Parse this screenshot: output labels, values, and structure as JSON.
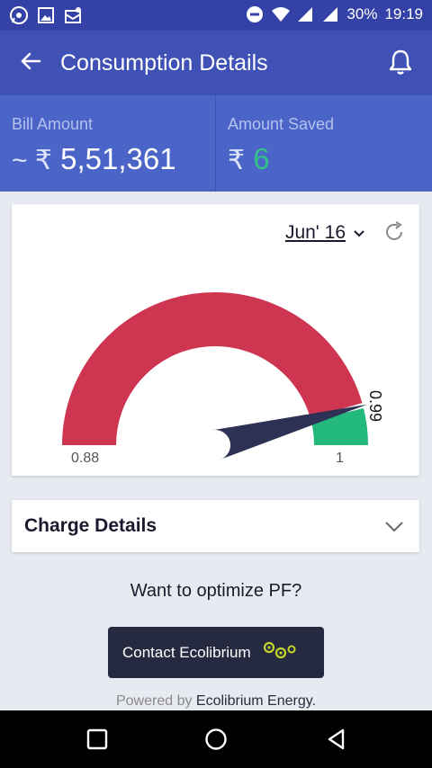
{
  "status_bar": {
    "battery": "30%",
    "time": "19:19",
    "icons": [
      "whatsapp-icon",
      "gallery-icon",
      "inbox-icon",
      "dnd-icon",
      "wifi-icon",
      "signal-icon",
      "signal-icon"
    ]
  },
  "app_bar": {
    "title": "Consumption Details",
    "back_icon": "arrow-left-icon",
    "bell_icon": "bell-icon"
  },
  "summary": {
    "bill_label": "Bill Amount",
    "bill_prefix": "~ ₹",
    "bill_value": "5,51,361",
    "saved_label": "Amount Saved",
    "saved_prefix": "₹",
    "saved_value": "6"
  },
  "gauge": {
    "month": "Jun' 16",
    "min_label": "0.88",
    "max_label": "1",
    "value_label": "0.99",
    "min": 0.88,
    "max": 1,
    "value": 0.99,
    "colors": {
      "red": "#cd3550",
      "green": "#23b87c",
      "needle": "#2d3153"
    }
  },
  "charge": {
    "label": "Charge Details"
  },
  "prompt": "Want to optimize PF?",
  "contact_button": "Contact Ecolibrium",
  "powered": {
    "prefix": "Powered by",
    "brand": "Ecolibrium Energy."
  },
  "colors": {
    "appbar": "#3f51b5",
    "statusbar": "#3442a8",
    "summary": "#4a64c7",
    "saved_green": "#35c08b",
    "button_dark": "#262a40"
  }
}
